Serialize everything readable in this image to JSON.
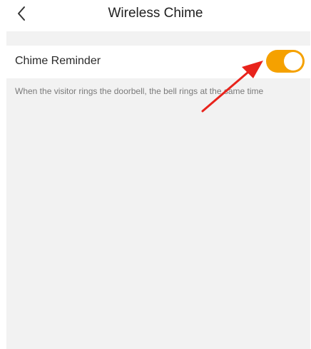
{
  "header": {
    "title": "Wireless Chime",
    "back_icon": "chevron-left-icon"
  },
  "settings": {
    "chime_reminder": {
      "label": "Chime Reminder",
      "enabled": true,
      "description": "When the visitor rings the doorbell, the bell rings at the same time"
    }
  },
  "colors": {
    "toggle_on": "#f5a100",
    "annotation_arrow": "#e8231c"
  }
}
